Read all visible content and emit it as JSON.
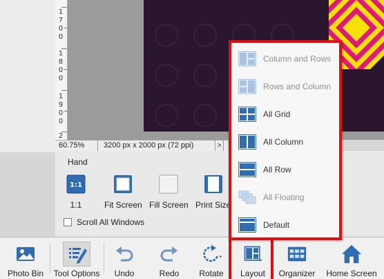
{
  "ruler": {
    "labels": [
      [
        "1",
        "7",
        "0",
        "0"
      ],
      [
        "1",
        "8",
        "0",
        "0"
      ],
      [
        "1",
        "9",
        "0",
        "0"
      ]
    ],
    "bottom": "2"
  },
  "status": {
    "zoom": "60.75%",
    "dimensions": "3200 px x 2000 px (72 ppi)",
    "arrow": ">"
  },
  "tool_options": {
    "title": "Hand",
    "options": [
      {
        "label": "1:1",
        "icon": "one-to-one-icon",
        "glyph": "1:1"
      },
      {
        "label": "Fit Screen",
        "icon": "fit-screen-icon"
      },
      {
        "label": "Fill Screen",
        "icon": "fill-screen-icon"
      },
      {
        "label": "Print Size",
        "icon": "print-size-icon"
      }
    ],
    "scroll_all_windows": "Scroll All Windows"
  },
  "layout_menu": {
    "items": [
      {
        "label": "Column and Rows",
        "icon": "column-and-rows-icon",
        "enabled": false
      },
      {
        "label": "Rows and Column",
        "icon": "rows-and-column-icon",
        "enabled": false
      },
      {
        "label": "All Grid",
        "icon": "all-grid-icon",
        "enabled": true
      },
      {
        "label": "All Column",
        "icon": "all-column-icon",
        "enabled": true
      },
      {
        "label": "All Row",
        "icon": "all-row-icon",
        "enabled": true
      },
      {
        "label": "All Floating",
        "icon": "all-floating-icon",
        "enabled": false
      },
      {
        "label": "Default",
        "icon": "default-layout-icon",
        "enabled": true
      }
    ]
  },
  "toolbar": {
    "photo_bin": "Photo Bin",
    "tool_options": "Tool Options",
    "undo": "Undo",
    "redo": "Redo",
    "rotate": "Rotate",
    "layout": "Layout",
    "organizer": "Organizer",
    "home_screen": "Home Screen"
  },
  "colors": {
    "highlight": "#e01010",
    "icon_blue": "#2f6db0",
    "image_bg": "#2b1630",
    "pattern_yellow": "#f5e10a",
    "pattern_pink": "#e0197d"
  }
}
